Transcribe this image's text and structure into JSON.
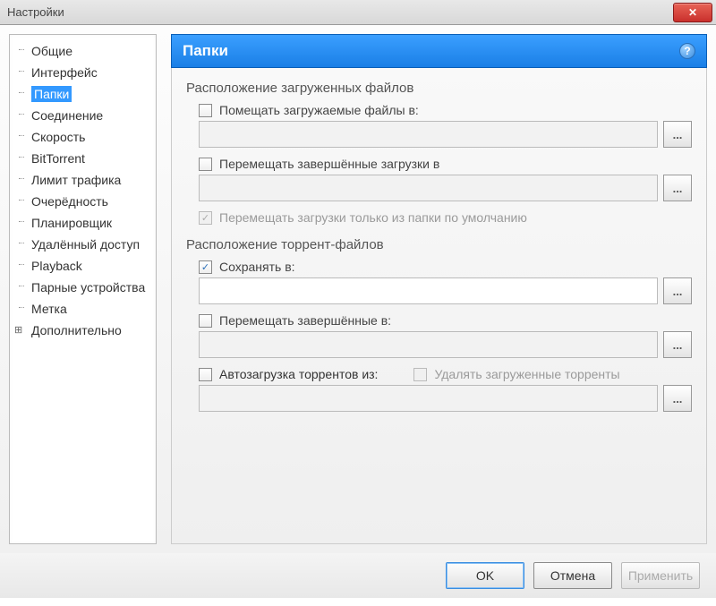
{
  "window": {
    "title": "Настройки"
  },
  "sidebar": {
    "items": [
      {
        "label": "Общие"
      },
      {
        "label": "Интерфейс"
      },
      {
        "label": "Папки",
        "selected": true
      },
      {
        "label": "Соединение"
      },
      {
        "label": "Скорость"
      },
      {
        "label": "BitTorrent"
      },
      {
        "label": "Лимит трафика"
      },
      {
        "label": "Очерёдность"
      },
      {
        "label": "Планировщик"
      },
      {
        "label": "Удалённый доступ"
      },
      {
        "label": "Playback"
      },
      {
        "label": "Парные устройства"
      },
      {
        "label": "Метка"
      },
      {
        "label": "Дополнительно",
        "expandable": true
      }
    ]
  },
  "panel": {
    "title": "Папки",
    "section1": "Расположение загруженных файлов",
    "put_in": "Помещать загружаемые файлы в:",
    "move_completed": "Перемещать завершённые загрузки в",
    "only_default": "Перемещать загрузки только из папки по умолчанию",
    "section2": "Расположение торрент-файлов",
    "save_in": "Сохранять в:",
    "save_path": "",
    "move_completed2": "Перемещать завершённые в:",
    "autoload": "Автозагрузка торрентов из:",
    "delete_loaded": "Удалять загруженные торренты"
  },
  "footer": {
    "ok": "OK",
    "cancel": "Отмена",
    "apply": "Применить"
  },
  "glyphs": {
    "browse": "...",
    "close": "✕",
    "help": "?"
  }
}
